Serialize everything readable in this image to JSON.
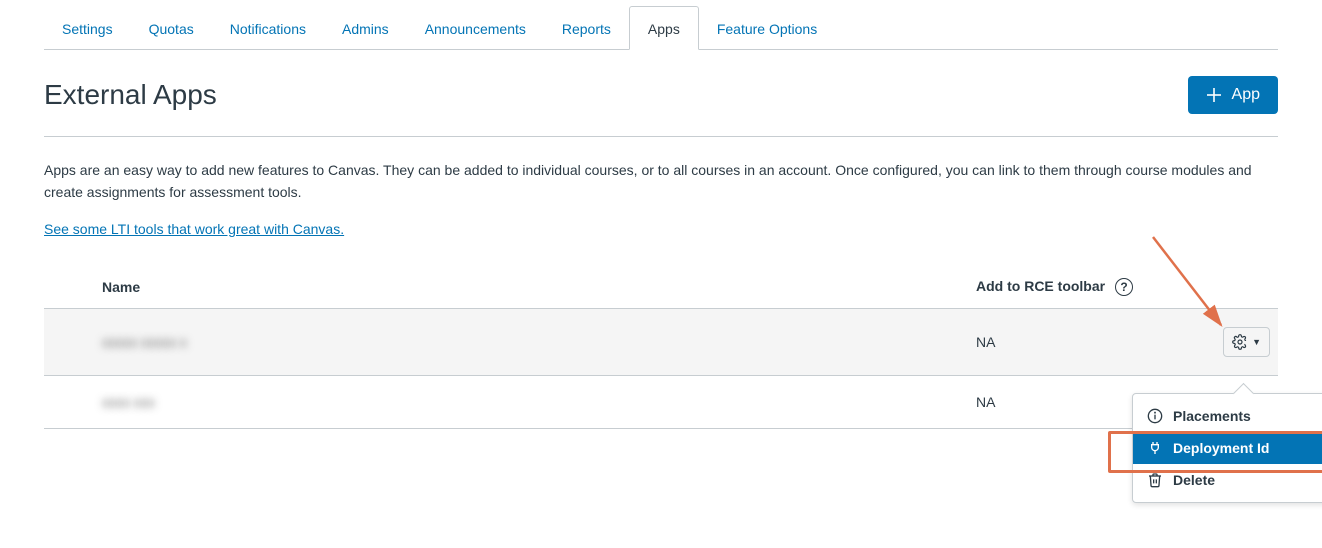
{
  "tabs": [
    {
      "label": "Settings"
    },
    {
      "label": "Quotas"
    },
    {
      "label": "Notifications"
    },
    {
      "label": "Admins"
    },
    {
      "label": "Announcements"
    },
    {
      "label": "Reports"
    },
    {
      "label": "Apps",
      "active": true
    },
    {
      "label": "Feature Options"
    }
  ],
  "page": {
    "title": "External Apps",
    "add_button": "App",
    "intro": "Apps are an easy way to add new features to Canvas. They can be added to individual courses, or to all courses in an account. Once configured, you can link to them through course modules and create assignments for assessment tools.",
    "link": "See some LTI tools that work great with Canvas."
  },
  "table": {
    "headers": {
      "name": "Name",
      "rce": "Add to RCE toolbar"
    },
    "rows": [
      {
        "name": "xxxxx xxxxx x",
        "rce": "NA"
      },
      {
        "name": "xxxx xxx",
        "rce": "NA"
      }
    ]
  },
  "menu": {
    "placements": "Placements",
    "deployment_id": "Deployment Id",
    "delete": "Delete"
  }
}
